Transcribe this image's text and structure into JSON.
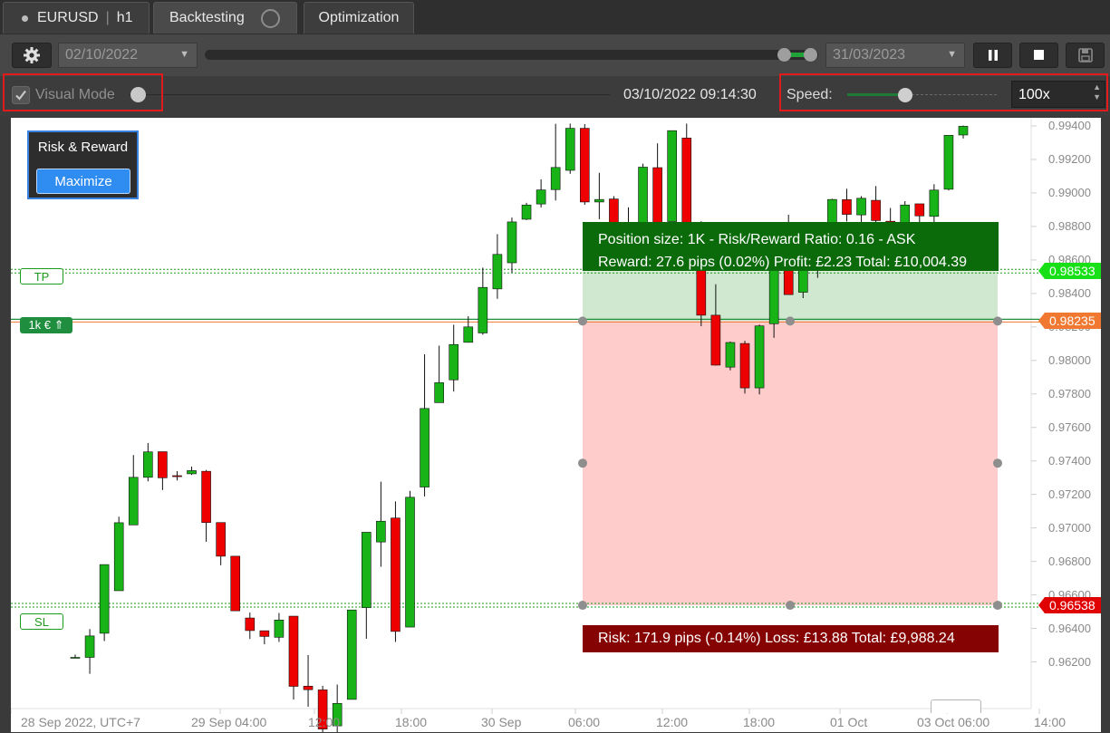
{
  "tabs": {
    "symbol": "EURUSD",
    "timeframe": "h1",
    "backtesting": "Backtesting",
    "optimization": "Optimization"
  },
  "toolbar": {
    "start_date": "02/10/2022",
    "end_date": "31/03/2023",
    "range_start_fraction": 0.9445,
    "range_end_fraction": 0.9865
  },
  "visual": {
    "label": "Visual Mode",
    "checked": true,
    "current_time": "03/10/2022 09:14:30",
    "speed_label": "Speed:",
    "speed_value": "100x",
    "speed_fraction": 0.39
  },
  "panel": {
    "title": "Risk & Reward",
    "maximize": "Maximize"
  },
  "position": {
    "line1": "Position size: 1K - Risk/Reward Ratio: 0.16 - ASK",
    "line2": "Reward: 27.6 pips (0.02%) Profit: £2.23 Total: £10,004.39",
    "risk": "Risk: 171.9 pips (-0.14%) Loss: £13.88 Total: £9,988.24",
    "tp_label": "TP",
    "sl_label": "SL",
    "entry_label": "1k € ⇑",
    "tp_price": "0.98533",
    "entry_price": "0.98235",
    "sl_price": "0.96538",
    "tp_value": 0.98533,
    "entry_value": 0.98235,
    "sl_value": 0.96538
  },
  "axis": {
    "y_ticks": [
      "0.99400",
      "0.99200",
      "0.99000",
      "0.98800",
      "0.98600",
      "0.98400",
      "0.98200",
      "0.98000",
      "0.97800",
      "0.97600",
      "0.97400",
      "0.97200",
      "0.97000",
      "0.96800",
      "0.96600",
      "0.96400",
      "0.96200"
    ],
    "x_ticks": [
      "28 Sep 2022, UTC+7",
      "29 Sep 04:00",
      "12:00",
      "18:00",
      "30 Sep",
      "06:00",
      "12:00",
      "18:00",
      "01 Oct",
      "03 Oct 06:00",
      "14:00"
    ]
  },
  "colors": {
    "bull": "#17b317",
    "bear": "#ee0000",
    "reward_fill": "#cfe8cf",
    "risk_fill": "#ffcccc",
    "tp_tag": "#17e017",
    "entry_tag": "#f07830",
    "sl_tag": "#e00000"
  },
  "chart_data": {
    "type": "candlestick",
    "candles": [
      [
        0.96227,
        0.96227,
        0.96221,
        0.96244
      ],
      [
        0.96227,
        0.96355,
        0.96129,
        0.96396
      ],
      [
        0.96371,
        0.96781,
        0.96324,
        0.96781
      ],
      [
        0.96625,
        0.97031,
        0.96625,
        0.97067
      ],
      [
        0.97018,
        0.97302,
        0.97018,
        0.97435
      ],
      [
        0.97302,
        0.97454,
        0.97278,
        0.97507
      ],
      [
        0.97455,
        0.97299,
        0.97226,
        0.97455
      ],
      [
        0.97312,
        0.97306,
        0.97283,
        0.97339
      ],
      [
        0.97323,
        0.97342,
        0.97316,
        0.97366
      ],
      [
        0.97338,
        0.97032,
        0.96917,
        0.97346
      ],
      [
        0.97032,
        0.96831,
        0.96777,
        0.96974
      ],
      [
        0.96831,
        0.96505,
        0.96505,
        0.96783
      ],
      [
        0.96462,
        0.96387,
        0.96337,
        0.96494
      ],
      [
        0.96386,
        0.96352,
        0.96305,
        0.96386
      ],
      [
        0.96347,
        0.9645,
        0.96319,
        0.96492
      ],
      [
        0.96473,
        0.96054,
        0.95975,
        0.96473
      ],
      [
        0.96055,
        0.96034,
        0.95932,
        0.96241
      ],
      [
        0.96033,
        0.95799,
        0.95753,
        0.96057
      ],
      [
        0.95818,
        0.95952,
        0.95716,
        0.96065
      ],
      [
        0.95976,
        0.9651,
        0.95976,
        0.9651
      ],
      [
        0.96524,
        0.96974,
        0.96338,
        0.96974
      ],
      [
        0.96916,
        0.9704,
        0.96768,
        0.97276
      ],
      [
        0.97059,
        0.96382,
        0.96319,
        0.97158
      ],
      [
        0.96408,
        0.97183,
        0.96408,
        0.97221
      ],
      [
        0.97244,
        0.97713,
        0.97188,
        0.98037
      ],
      [
        0.97748,
        0.97867,
        0.97748,
        0.98088
      ],
      [
        0.97884,
        0.98095,
        0.97814,
        0.98213
      ],
      [
        0.98108,
        0.982,
        0.98106,
        0.98264
      ],
      [
        0.98164,
        0.98436,
        0.98153,
        0.98554
      ],
      [
        0.98427,
        0.98633,
        0.98368,
        0.98754
      ],
      [
        0.98583,
        0.98827,
        0.98524,
        0.98853
      ],
      [
        0.98843,
        0.98928,
        0.98838,
        0.98941
      ],
      [
        0.98934,
        0.99018,
        0.98913,
        0.99081
      ],
      [
        0.9902,
        0.99152,
        0.98955,
        0.99413
      ],
      [
        0.99135,
        0.99386,
        0.99114,
        0.99414
      ],
      [
        0.99386,
        0.98946,
        0.98929,
        0.99411
      ],
      [
        0.98946,
        0.98961,
        0.98843,
        0.9912
      ],
      [
        0.98964,
        0.98808,
        0.98766,
        0.98981
      ],
      [
        0.98808,
        0.98798,
        0.98779,
        0.98914
      ],
      [
        0.98807,
        0.99154,
        0.98814,
        0.99175
      ],
      [
        0.99151,
        0.98825,
        0.98782,
        0.99296
      ],
      [
        0.98829,
        0.99372,
        0.98829,
        0.99373
      ],
      [
        0.99328,
        0.98817,
        0.98792,
        0.99414
      ],
      [
        0.98822,
        0.9827,
        0.98204,
        0.98831
      ],
      [
        0.9827,
        0.97972,
        0.97969,
        0.98455
      ],
      [
        0.9796,
        0.98107,
        0.97941,
        0.98113
      ],
      [
        0.98101,
        0.97836,
        0.97802,
        0.98117
      ],
      [
        0.97836,
        0.98206,
        0.97797,
        0.98214
      ],
      [
        0.98219,
        0.98613,
        0.98135,
        0.98623
      ],
      [
        0.98612,
        0.98393,
        0.98393,
        0.9887
      ],
      [
        0.98407,
        0.9858,
        0.98372,
        0.98734
      ],
      [
        0.98589,
        0.98719,
        0.98493,
        0.98726
      ],
      [
        0.98726,
        0.98961,
        0.98625,
        0.98965
      ],
      [
        0.9896,
        0.98872,
        0.9883,
        0.99025
      ],
      [
        0.98869,
        0.98968,
        0.98764,
        0.98981
      ],
      [
        0.98956,
        0.98835,
        0.98818,
        0.99041
      ],
      [
        0.98831,
        0.98822,
        0.98732,
        0.9891
      ],
      [
        0.9882,
        0.98928,
        0.98802,
        0.98951
      ],
      [
        0.98935,
        0.98863,
        0.98808,
        0.98924
      ],
      [
        0.9886,
        0.99017,
        0.98807,
        0.99052
      ],
      [
        0.99022,
        0.99344,
        0.99015,
        0.99335
      ],
      [
        0.99346,
        0.99398,
        0.99325,
        0.99403
      ]
    ],
    "y_range": [
      0.961,
      0.994
    ],
    "grid": true
  }
}
